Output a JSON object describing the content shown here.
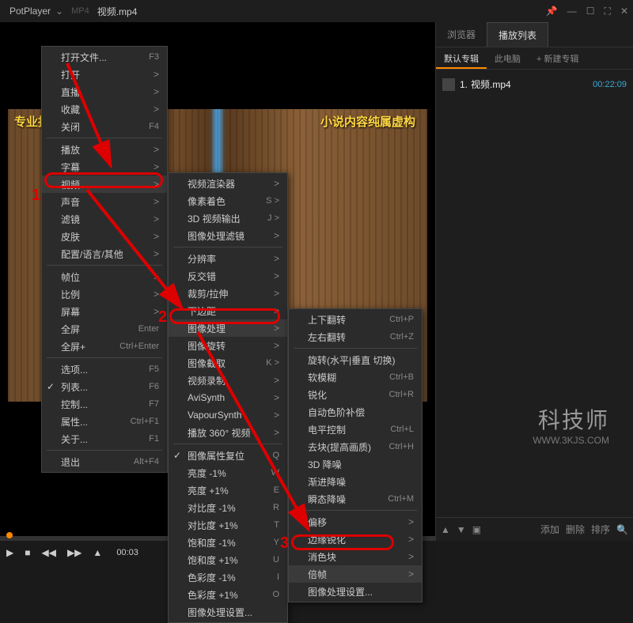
{
  "titlebar": {
    "app": "PotPlayer",
    "format": "MP4",
    "file": "视频.mp4"
  },
  "subtitles": {
    "left": "专业报",
    "right": "小说内容纯属虚构"
  },
  "sidebar": {
    "tabs": {
      "browser": "浏览器",
      "playlist": "播放列表"
    },
    "albums": {
      "default": "默认专辑",
      "pc": "此电脑",
      "new": "+ 新建专辑"
    },
    "item": {
      "index": "1.",
      "name": "视频.mp4",
      "duration": "00:22:09"
    },
    "footer": {
      "add": "添加",
      "delete": "删除",
      "sort": "排序"
    }
  },
  "watermark": {
    "big": "科技师",
    "small": "WWW.3KJS.COM"
  },
  "controls": {
    "time": "00:03"
  },
  "annotations": {
    "n1": "1",
    "n2": "2",
    "n3": "3"
  },
  "menu1": [
    {
      "label": "打开文件...",
      "shortcut": "F3"
    },
    {
      "label": "打开",
      "arrow": ">"
    },
    {
      "label": "直播",
      "arrow": ">"
    },
    {
      "label": "收藏",
      "arrow": ">"
    },
    {
      "label": "关闭",
      "shortcut": "F4"
    },
    {
      "sep": true
    },
    {
      "label": "播放",
      "arrow": ">"
    },
    {
      "label": "字幕",
      "arrow": ">"
    },
    {
      "label": "视频",
      "arrow": ">",
      "hl": true
    },
    {
      "label": "声音",
      "arrow": ">"
    },
    {
      "label": "滤镜",
      "arrow": ">"
    },
    {
      "label": "皮肤",
      "arrow": ">"
    },
    {
      "label": "配置/语言/其他",
      "arrow": ">"
    },
    {
      "sep": true
    },
    {
      "label": "帧位",
      "arrow": ">"
    },
    {
      "label": "比例",
      "arrow": ">"
    },
    {
      "label": "屏幕",
      "arrow": ">"
    },
    {
      "label": "全屏",
      "shortcut": "Enter"
    },
    {
      "label": "全屏+",
      "shortcut": "Ctrl+Enter"
    },
    {
      "sep": true
    },
    {
      "label": "选项...",
      "shortcut": "F5"
    },
    {
      "label": "列表...",
      "shortcut": "F6",
      "check": true
    },
    {
      "label": "控制...",
      "shortcut": "F7"
    },
    {
      "label": "属性...",
      "shortcut": "Ctrl+F1"
    },
    {
      "label": "关于...",
      "shortcut": "F1"
    },
    {
      "sep": true
    },
    {
      "label": "退出",
      "shortcut": "Alt+F4"
    }
  ],
  "menu2": [
    {
      "label": "视频渲染器",
      "arrow": ">"
    },
    {
      "label": "像素着色",
      "shortcut": "S >"
    },
    {
      "label": "3D 视频输出",
      "shortcut": "J >"
    },
    {
      "label": "图像处理滤镜",
      "arrow": ">"
    },
    {
      "sep": true
    },
    {
      "label": "分辨率",
      "arrow": ">"
    },
    {
      "label": "反交错",
      "arrow": ">"
    },
    {
      "label": "裁剪/拉伸",
      "arrow": ">"
    },
    {
      "label": "下边距",
      "arrow": ">"
    },
    {
      "label": "图像处理",
      "arrow": ">",
      "hl": true
    },
    {
      "label": "图像旋转",
      "arrow": ">"
    },
    {
      "label": "图像截取",
      "shortcut": "K >"
    },
    {
      "label": "视频录制",
      "arrow": ">"
    },
    {
      "label": "AviSynth",
      "arrow": ">"
    },
    {
      "label": "VapourSynth",
      "arrow": ">"
    },
    {
      "label": "播放 360° 视频",
      "arrow": ">"
    },
    {
      "sep": true
    },
    {
      "label": "图像属性复位",
      "shortcut": "Q",
      "check": true
    },
    {
      "label": "亮度 -1%",
      "shortcut": "W"
    },
    {
      "label": "亮度 +1%",
      "shortcut": "E"
    },
    {
      "label": "对比度 -1%",
      "shortcut": "R"
    },
    {
      "label": "对比度 +1%",
      "shortcut": "T"
    },
    {
      "label": "饱和度 -1%",
      "shortcut": "Y"
    },
    {
      "label": "饱和度 +1%",
      "shortcut": "U"
    },
    {
      "label": "色彩度 -1%",
      "shortcut": "I"
    },
    {
      "label": "色彩度 +1%",
      "shortcut": "O"
    },
    {
      "label": "图像处理设置..."
    }
  ],
  "menu3": [
    {
      "label": "上下翻转",
      "shortcut": "Ctrl+P"
    },
    {
      "label": "左右翻转",
      "shortcut": "Ctrl+Z"
    },
    {
      "sep": true
    },
    {
      "label": "旋转(水平|垂直 切换)"
    },
    {
      "label": "软模糊",
      "shortcut": "Ctrl+B"
    },
    {
      "label": "锐化",
      "shortcut": "Ctrl+R"
    },
    {
      "label": "自动色阶补偿"
    },
    {
      "label": "电平控制",
      "shortcut": "Ctrl+L"
    },
    {
      "label": "去块(提高画质)",
      "shortcut": "Ctrl+H"
    },
    {
      "label": "3D 降噪"
    },
    {
      "label": "渐进降噪"
    },
    {
      "label": "瞬态降噪",
      "shortcut": "Ctrl+M"
    },
    {
      "sep": true
    },
    {
      "label": "偏移",
      "arrow": ">"
    },
    {
      "label": "边缘锐化",
      "arrow": ">"
    },
    {
      "label": "消色块",
      "arrow": ">"
    },
    {
      "label": "倍帧",
      "arrow": ">",
      "hl": true
    },
    {
      "label": "图像处理设置..."
    }
  ]
}
